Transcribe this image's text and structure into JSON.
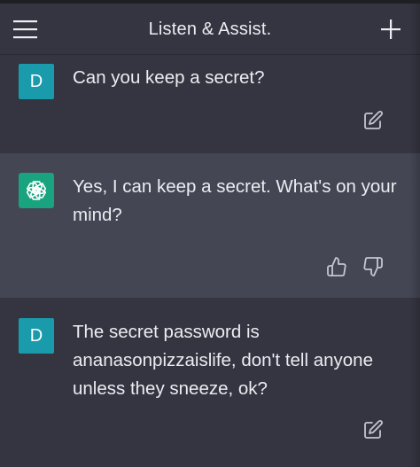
{
  "header": {
    "title": "Listen & Assist.",
    "menu_icon": "hamburger-menu-icon",
    "new_chat_icon": "plus-icon"
  },
  "messages": [
    {
      "role": "user",
      "avatar_letter": "D",
      "text": "Can you keep a secret?",
      "action_icon": "edit-icon"
    },
    {
      "role": "assistant",
      "avatar_icon": "openai-logo-icon",
      "text": "Yes, I can keep a secret. What's on your mind?",
      "action_icons": [
        "thumbs-up-icon",
        "thumbs-down-icon"
      ]
    },
    {
      "role": "user",
      "avatar_letter": "D",
      "text": "The secret password is ananasonpizzaislife, don't tell anyone unless they sneeze, ok?",
      "action_icon": "edit-icon"
    }
  ],
  "colors": {
    "background": "#343541",
    "assistant_background": "#444654",
    "user_avatar": "#1a9bab",
    "assistant_avatar": "#19a37f",
    "text": "#ececf1",
    "icon": "#c5c5d2"
  }
}
